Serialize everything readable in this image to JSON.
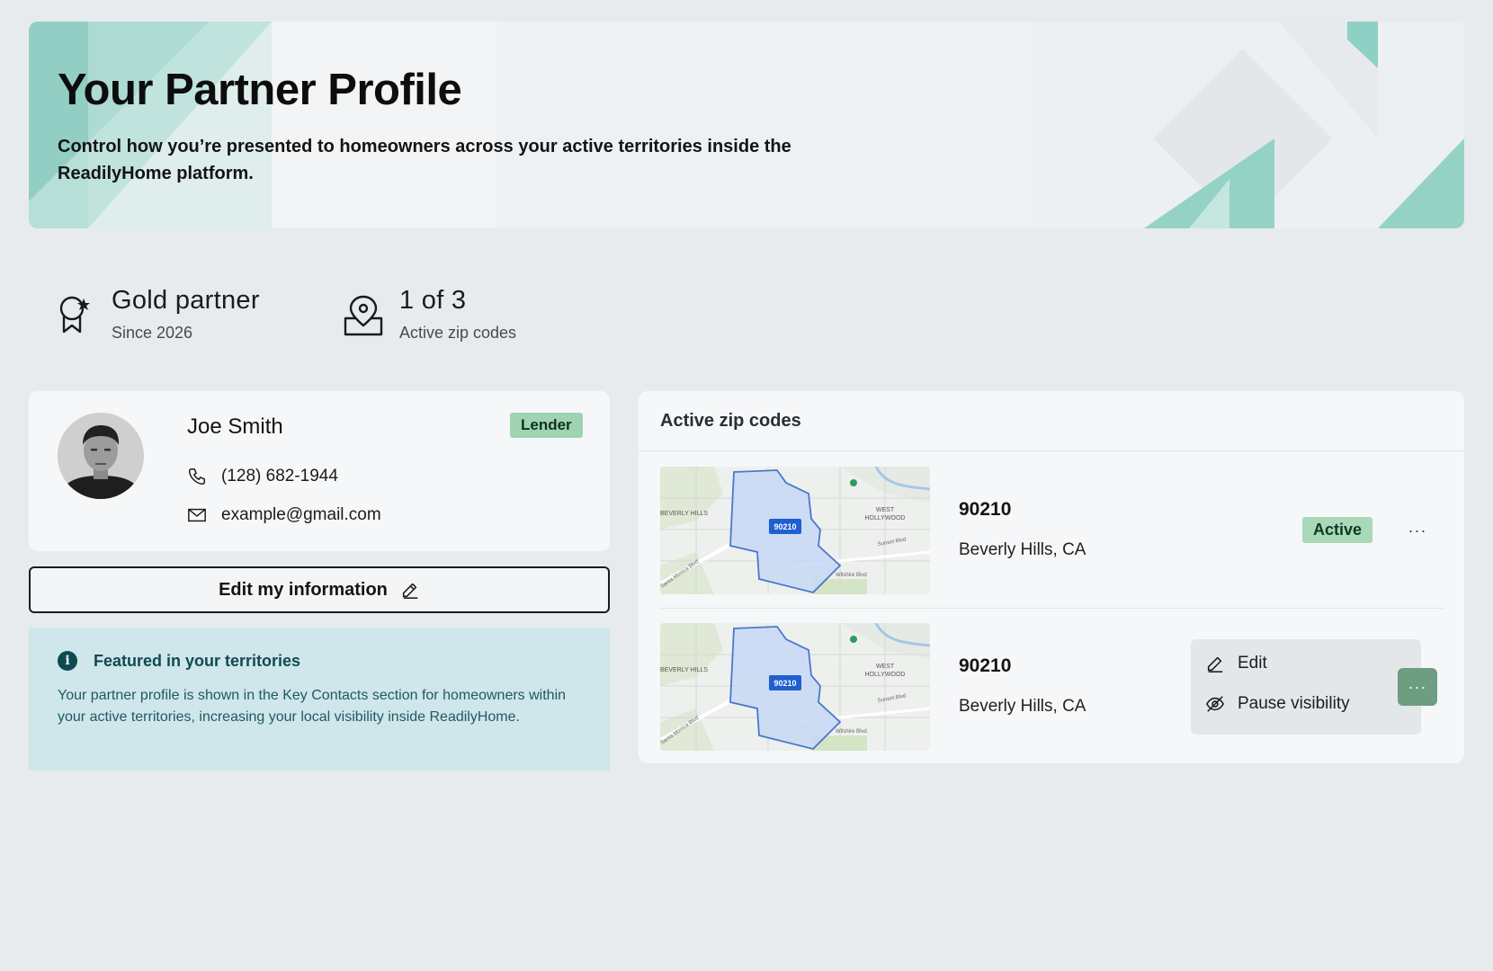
{
  "hero": {
    "title": "Your Partner Profile",
    "subtitle": "Control how you’re presented to homeowners across your active territories inside the ReadilyHome platform."
  },
  "stats": [
    {
      "icon": "award-ribbon-icon",
      "value": "Gold partner",
      "label": "Since 2026"
    },
    {
      "icon": "map-pin-icon",
      "value": "1 of 3",
      "label": "Active zip codes"
    }
  ],
  "profile": {
    "name": "Joe Smith",
    "role_badge": "Lender",
    "phone": "(128) 682-1944",
    "email": "example@gmail.com",
    "avatar_icon": "avatar-photo"
  },
  "edit_button": {
    "label": "Edit my information",
    "icon": "pencil-icon"
  },
  "info_box": {
    "title": "Featured in your territories",
    "body": "Your partner profile is shown in the Key Contacts section for homeowners within your active territories, increasing your local visibility inside ReadilyHome."
  },
  "zip_panel": {
    "title": "Active zip codes",
    "rows": [
      {
        "zip": "90210",
        "city": "Beverly Hills, CA",
        "status": "Active",
        "map_label": "90210",
        "menu_open": false
      },
      {
        "zip": "90210",
        "city": "Beverly Hills, CA",
        "status": "",
        "map_label": "90210",
        "menu_open": true
      }
    ],
    "map_text": {
      "left": "BEVERLY HILLS",
      "right_top": "WEST",
      "right_bottom": "HOLLYWOOD",
      "road1": "Sunset Blvd",
      "road2": "Wilshire Blvd",
      "road3": "Santa Monica Blvd"
    },
    "more_label": "···",
    "menu": {
      "edit": "Edit",
      "pause": "Pause visibility"
    }
  },
  "colors": {
    "accent": "#9fd3b1",
    "info_bg": "#cfe6ea",
    "teal": "#7cc9bd"
  }
}
